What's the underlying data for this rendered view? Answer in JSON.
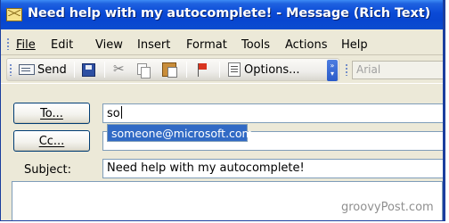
{
  "window": {
    "title": "Need help with my autocomplete! - Message (Rich Text)",
    "titlebar_color": "#0a49d6"
  },
  "menu": [
    {
      "label": "File"
    },
    {
      "label": "Edit"
    },
    {
      "label": "View"
    },
    {
      "label": "Insert"
    },
    {
      "label": "Format"
    },
    {
      "label": "Tools"
    },
    {
      "label": "Actions"
    },
    {
      "label": "Help"
    }
  ],
  "toolbar": {
    "send_label": "Send",
    "options_label": "Options...",
    "font_value": "Arial",
    "icons": [
      "send-icon",
      "save-icon",
      "cut-icon",
      "copy-icon",
      "paste-icon",
      "flag-icon",
      "options-icon",
      "toolbar-overflow-icon"
    ]
  },
  "header": {
    "to_button": "To...",
    "cc_button": "Cc...",
    "subject_label": "Subject:",
    "to_value": "so",
    "cc_value": "",
    "subject_value": "Need help with my autocomplete!"
  },
  "autocomplete": {
    "suggestion": "someone@microsoft.com",
    "highlight_color": "#316ac5"
  },
  "watermark": "groovyPost.com"
}
